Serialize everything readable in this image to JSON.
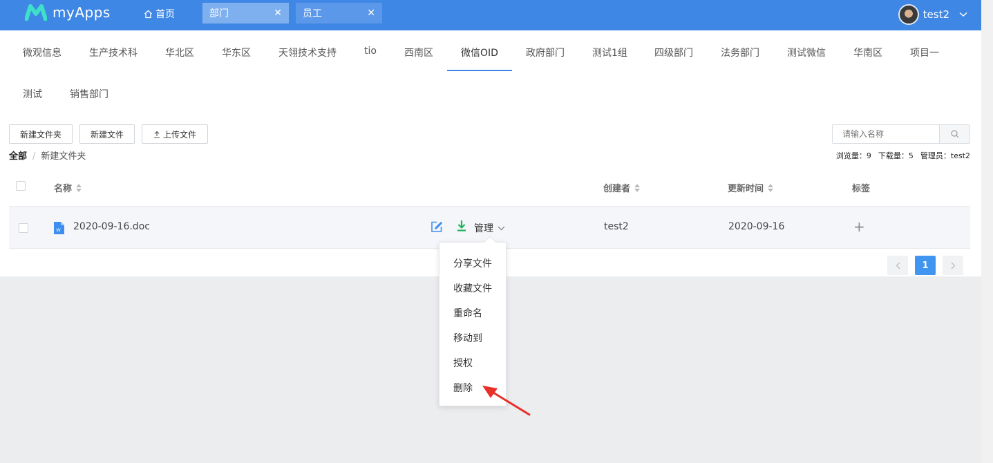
{
  "app": {
    "name": "myApps"
  },
  "topbar": {
    "home_label": "首页",
    "tabs": [
      {
        "label": "部门"
      },
      {
        "label": "员工"
      }
    ],
    "user_name": "test2"
  },
  "departments": [
    "微观信息",
    "生产技术科",
    "华北区",
    "华东区",
    "天翎技术支持",
    "tio",
    "西南区",
    "微信OID",
    "政府部门",
    "测试1组",
    "四级部门",
    "法务部门",
    "测试微信",
    "华南区",
    "项目一",
    "测试",
    "销售部门"
  ],
  "active_department": "微信OID",
  "toolbar": {
    "new_folder": "新建文件夹",
    "new_file": "新建文件",
    "upload": "上传文件",
    "search_placeholder": "请输入名称"
  },
  "breadcrumb": {
    "root": "全部",
    "sep": "/",
    "current": "新建文件夹"
  },
  "stats": {
    "views": "浏览量：9",
    "downloads": "下载量：5",
    "admin": "管理员：test2"
  },
  "table": {
    "headers": {
      "name": "名称",
      "creator": "创建者",
      "updated": "更新时间",
      "tags": "标签"
    },
    "rows": [
      {
        "name": "2020-09-16.doc",
        "manage": "管理",
        "creator": "test2",
        "updated": "2020-09-16",
        "tag_add": "+"
      }
    ]
  },
  "pagination": {
    "current": "1"
  },
  "manage_menu": [
    "分享文件",
    "收藏文件",
    "重命名",
    "移动到",
    "授权",
    "删除"
  ],
  "colors": {
    "primary": "#3f87e5",
    "download": "#1fb35d",
    "annotation_arrow": "#e8302a"
  }
}
